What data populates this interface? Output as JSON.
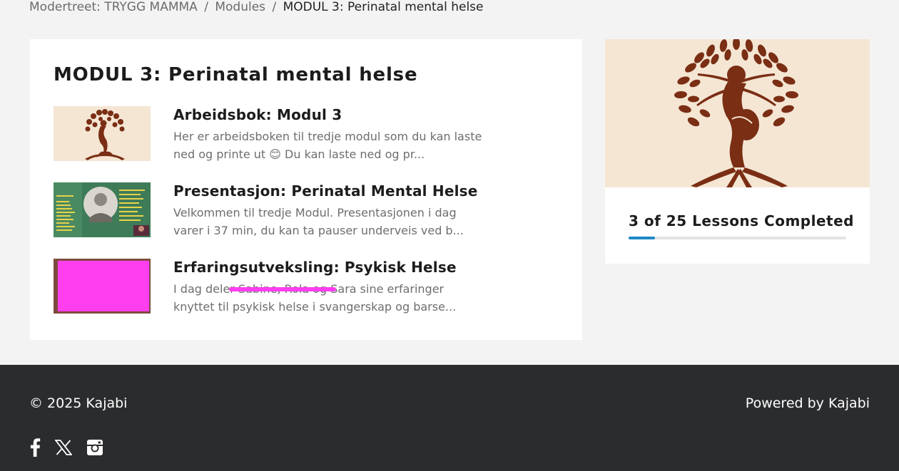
{
  "breadcrumb": {
    "product": "Modertreet: TRYGG MAMMA",
    "modules": "Modules",
    "current": "MODUL 3: Perinatal mental helse",
    "separator": "/"
  },
  "module": {
    "title": "MODUL 3: Perinatal mental helse",
    "lessons": [
      {
        "title": "Arbeidsbok: Modul 3",
        "description": "Her er arbeidsboken til tredje modul som du kan laste ned og printe ut 😊  Du kan laste ned og pr...",
        "thumbnail": "tree-of-mother-logo"
      },
      {
        "title": "Presentasjon: Perinatal Mental Helse",
        "description": "Velkommen til tredje Modul. Presentasjonen i dag varer i 37 min, du kan ta pauser underveis ved b...",
        "thumbnail": "presentation-slide"
      },
      {
        "title": "Erfaringsutveksling: Psykisk Helse",
        "description": "I dag deler Sabine, Rola og Sara sine erfaringer knyttet til psykisk helse i svangerskap og barse...",
        "thumbnail": "redacted-video-thumbnail"
      }
    ]
  },
  "progress": {
    "label": "3 of 25 Lessons Completed",
    "completed": 3,
    "total": 25,
    "fraction": 0.12
  },
  "footer": {
    "copyright": "© 2025 Kajabi",
    "powered_by": "Powered by Kajabi",
    "socials": [
      "facebook-icon",
      "x-icon",
      "instagram-icon"
    ]
  },
  "colors": {
    "accent": "#1e88c8",
    "footer_bg": "#2b2c2e",
    "tree_brown": "#7a2e14",
    "tree_bg": "#f4e6d3",
    "redaction_magenta": "#ff3ef0"
  }
}
